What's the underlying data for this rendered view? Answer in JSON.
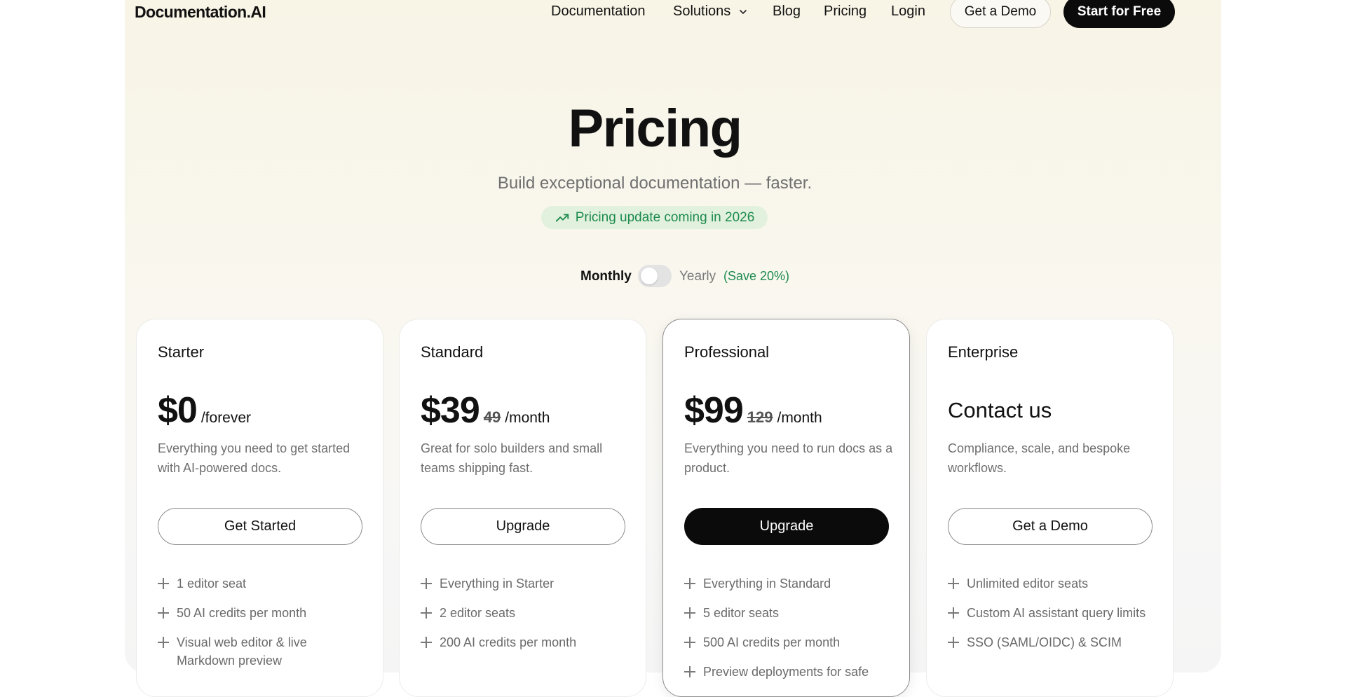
{
  "nav": {
    "logo": "Documentation.AI",
    "links": [
      "Documentation",
      "Solutions",
      "Blog",
      "Pricing",
      "Login"
    ],
    "demo_button": "Get a Demo",
    "start_button": "Start for Free"
  },
  "hero": {
    "title": "Pricing",
    "subtitle": "Build exceptional documentation — faster.",
    "notice": "Pricing update coming in 2026"
  },
  "billing_toggle": {
    "monthly": "Monthly",
    "yearly": "Yearly",
    "save": "(Save 20%)",
    "selected": "Monthly"
  },
  "colors": {
    "accent_green": "#1d8a4e",
    "dark": "#0b0b0b"
  },
  "plans": [
    {
      "name": "Starter",
      "price": "$0",
      "old_price": "",
      "period": "/forever",
      "description": "Everything you need to get started with AI-powered docs.",
      "cta": "Get Started",
      "features": [
        "1 editor seat",
        "50 AI credits per month",
        "Visual web editor & live Markdown preview"
      ]
    },
    {
      "name": "Standard",
      "price": "$39",
      "old_price": "49",
      "period": "/month",
      "description": "Great for solo builders and small teams shipping fast.",
      "cta": "Upgrade",
      "features": [
        "Everything in Starter",
        "2 editor seats",
        "200 AI credits per month"
      ]
    },
    {
      "name": "Professional",
      "price": "$99",
      "old_price": "129",
      "period": "/month",
      "description": "Everything you need to run docs as a product.",
      "cta": "Upgrade",
      "features": [
        "Everything in Standard",
        "5 editor seats",
        "500 AI credits per month",
        "Preview deployments for safe"
      ]
    },
    {
      "name": "Enterprise",
      "contact": "Contact us",
      "description": "Compliance, scale, and bespoke workflows.",
      "cta": "Get a Demo",
      "features": [
        "Unlimited editor seats",
        "Custom AI assistant query limits",
        "SSO (SAML/OIDC) & SCIM"
      ]
    }
  ]
}
